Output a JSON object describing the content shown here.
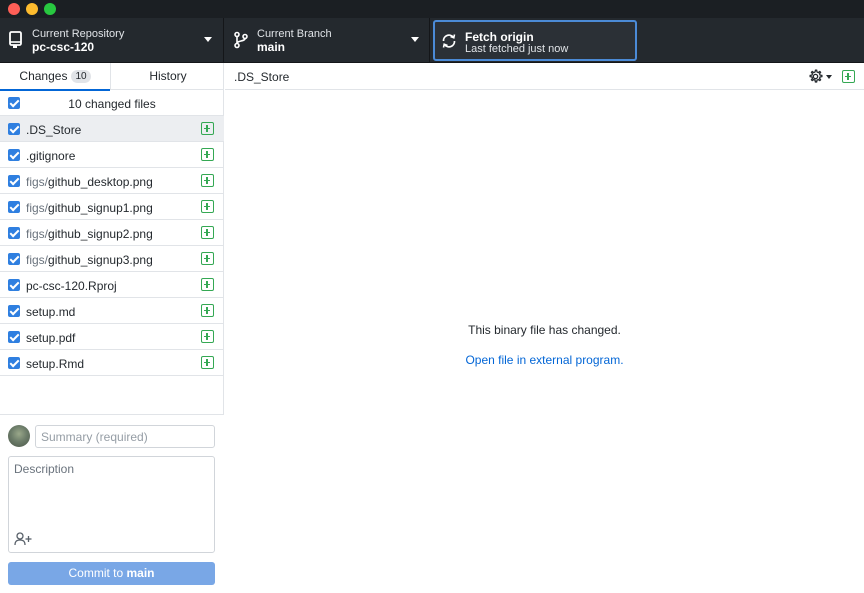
{
  "window": {
    "traffic_lights": [
      "close",
      "minimize",
      "zoom"
    ]
  },
  "toolbar": {
    "repository": {
      "label": "Current Repository",
      "value": "pc-csc-120",
      "icon": "repo-icon"
    },
    "branch": {
      "label": "Current Branch",
      "value": "main",
      "icon": "branch-icon"
    },
    "fetch": {
      "label": "Fetch origin",
      "status": "Last fetched just now",
      "icon": "sync-icon"
    }
  },
  "sidebar": {
    "tabs": {
      "changes": {
        "label": "Changes",
        "count": "10"
      },
      "history": {
        "label": "History"
      }
    },
    "files_header": "10 changed files",
    "files": [
      {
        "dir": "",
        "name": ".DS_Store",
        "checked": true,
        "status": "added",
        "selected": true
      },
      {
        "dir": "",
        "name": ".gitignore",
        "checked": true,
        "status": "added"
      },
      {
        "dir": "figs/",
        "name": "github_desktop.png",
        "checked": true,
        "status": "added"
      },
      {
        "dir": "figs/",
        "name": "github_signup1.png",
        "checked": true,
        "status": "added"
      },
      {
        "dir": "figs/",
        "name": "github_signup2.png",
        "checked": true,
        "status": "added"
      },
      {
        "dir": "figs/",
        "name": "github_signup3.png",
        "checked": true,
        "status": "added"
      },
      {
        "dir": "",
        "name": "pc-csc-120.Rproj",
        "checked": true,
        "status": "added"
      },
      {
        "dir": "",
        "name": "setup.md",
        "checked": true,
        "status": "added"
      },
      {
        "dir": "",
        "name": "setup.pdf",
        "checked": true,
        "status": "added"
      },
      {
        "dir": "",
        "name": "setup.Rmd",
        "checked": true,
        "status": "added"
      }
    ],
    "commit": {
      "summary_placeholder": "Summary (required)",
      "summary_value": "",
      "description_placeholder": "Description",
      "description_value": "",
      "button_prefix": "Commit to ",
      "button_branch": "main"
    }
  },
  "main": {
    "title": ".DS_Store",
    "message": "This binary file has changed.",
    "link": "Open file in external program."
  },
  "colors": {
    "toolbar_bg": "#24292e",
    "accent": "#0366d6",
    "added": "#34a853",
    "checkbox": "#2f7fe0",
    "commit_button": "#79a7e6",
    "fetch_border": "#4b8ad6"
  }
}
